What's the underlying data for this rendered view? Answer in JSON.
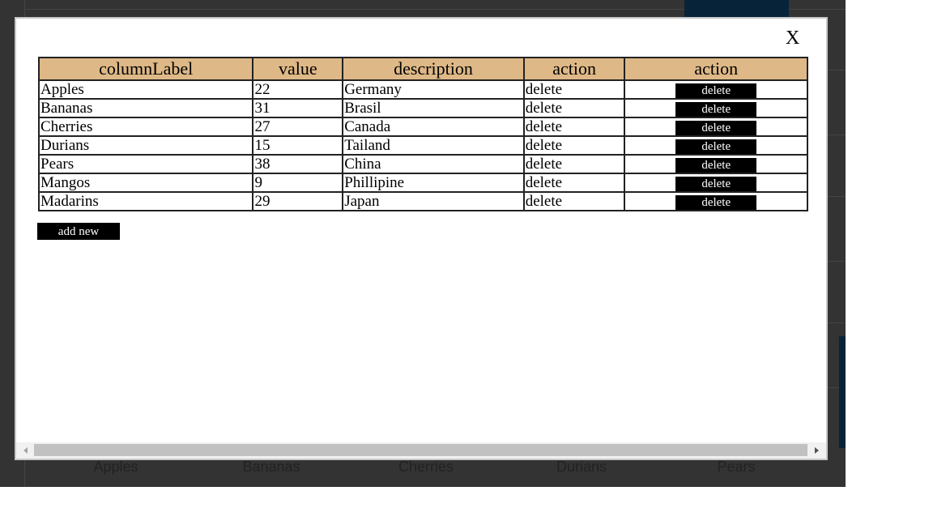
{
  "background": {
    "categories": [
      "Apples",
      "Bananas",
      "Cherries",
      "Durians",
      "Pears"
    ]
  },
  "modal": {
    "close_label": "X",
    "table": {
      "headers": [
        "columnLabel",
        "value",
        "description",
        "action",
        "action"
      ],
      "rows": [
        {
          "label": "Apples",
          "value": "22",
          "description": "Germany",
          "action_text": "delete",
          "button": "delete"
        },
        {
          "label": "Bananas",
          "value": "31",
          "description": "Brasil",
          "action_text": "delete",
          "button": "delete"
        },
        {
          "label": "Cherries",
          "value": "27",
          "description": "Canada",
          "action_text": "delete",
          "button": "delete"
        },
        {
          "label": "Durians",
          "value": "15",
          "description": "Tailand",
          "action_text": "delete",
          "button": "delete"
        },
        {
          "label": "Pears",
          "value": "38",
          "description": "China",
          "action_text": "delete",
          "button": "delete"
        },
        {
          "label": "Mangos",
          "value": "9",
          "description": "Phillipine",
          "action_text": "delete",
          "button": "delete"
        },
        {
          "label": "Madarins",
          "value": "29",
          "description": "Japan",
          "action_text": "delete",
          "button": "delete"
        }
      ]
    },
    "add_new_label": "add new"
  },
  "colors": {
    "header_bg": "#deb887",
    "button_bg": "#000000",
    "backdrop": "#333333",
    "chart_bar": "#06233a"
  }
}
